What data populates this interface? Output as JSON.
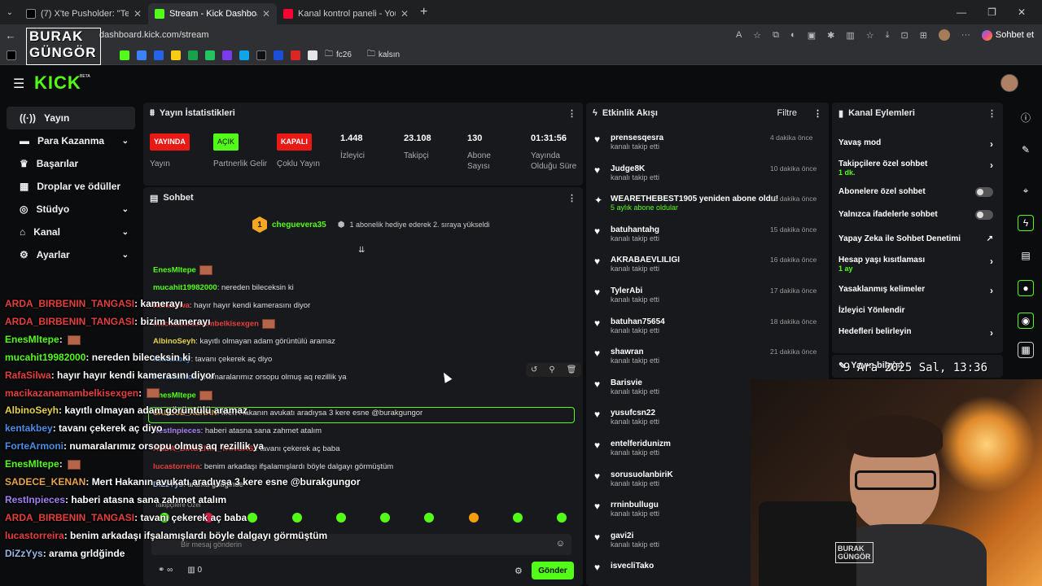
{
  "browser": {
    "tabs": [
      {
        "title": "(7) X'te Pusholder: \"Telefon dolandı",
        "color": "#222"
      },
      {
        "title": "Stream - Kick Dashboard",
        "color": "#53fc18"
      },
      {
        "title": "Kanal kontrol paneli - YouTube Stu",
        "color": "#ff0033"
      }
    ],
    "url": "dashboard.kick.com/stream",
    "copilot_label": "Sohbet et",
    "bookmarks": [
      "fc26",
      "kalsın"
    ]
  },
  "watermark": {
    "line1": "BURAK",
    "line2": "GÜNGÖR"
  },
  "clock": "9 Ara 2025 Sal, 13:36",
  "kick": {
    "logo": "KICK",
    "beta": "BETA",
    "nav": [
      {
        "label": "Yayın",
        "icon": "broadcast-icon",
        "chev": false
      },
      {
        "label": "Para Kazanma",
        "icon": "money-icon",
        "chev": true
      },
      {
        "label": "Başarılar",
        "icon": "trophy-icon",
        "chev": false
      },
      {
        "label": "Droplar ve ödüller",
        "icon": "gift-icon",
        "chev": false
      },
      {
        "label": "Stüdyo",
        "icon": "studio-icon",
        "chev": true
      },
      {
        "label": "Kanal",
        "icon": "channel-icon",
        "chev": true
      },
      {
        "label": "Ayarlar",
        "icon": "gear-icon",
        "chev": true
      }
    ]
  },
  "stats": {
    "title": "Yayın İstatistikleri",
    "live_badge": "YAYINDA",
    "live_label": "Yayın",
    "partner_badge": "AÇIK",
    "partner_label": "Partnerlik Gelir",
    "multi_badge": "KAPALI",
    "multi_label": "Çoklu Yayın",
    "viewers": "1.448",
    "viewers_label": "İzleyici",
    "followers": "23.108",
    "followers_label": "Takipçi",
    "subs": "130",
    "subs_label": "Abone Sayısı",
    "uptime": "01:31:56",
    "uptime_label": "Yayında Olduğu Süre"
  },
  "chat": {
    "title": "Sohbet",
    "pinned_user": "cheguevera35",
    "pinned_count": "1",
    "pinned_text": "1 abonelik hediye ederek 2. sıraya yükseldi",
    "messages": [
      {
        "user": "EnesMltepe",
        "color": "#53fc18",
        "text": ""
      },
      {
        "user": "mucahit19982000",
        "color": "#53fc18",
        "text": ": nereden bileceksin ki"
      },
      {
        "user": "RafaSilwa",
        "color": "#e53e3e",
        "text": ": hayır hayır kendi kamerasını diyor"
      },
      {
        "user": "macikazanamambelkisexgen",
        "color": "#e53e3e",
        "text": ""
      },
      {
        "user": "AlbinoSeyh",
        "color": "#e6d34a",
        "text": ": kayıtlı olmayan adam görüntülü aramaz"
      },
      {
        "user": "kentakbey",
        "color": "#4a8fe6",
        "text": ": tavanı çekerek aç diyo"
      },
      {
        "user": "ForteArmoni",
        "color": "#4a8fe6",
        "text": ": numaralarımız orsopu olmuş aq rezillik ya"
      },
      {
        "user": "EnesMltepe",
        "color": "#53fc18",
        "text": ""
      },
      {
        "user": "SADECE_KENAN",
        "color": "#e6a54a",
        "text": ": Mert Hakanın avukatı aradıysa 3 kere esne @burakgungor"
      },
      {
        "user": "RestInpieces",
        "color": "#a47ef0",
        "text": ": haberi atasna sana zahmet atalım"
      },
      {
        "user": "ARDA_BIRBENIN_TANGASI",
        "color": "#e53e3e",
        "text": ": tavanı çekerek aç baba"
      },
      {
        "user": "lucastorreira",
        "color": "#e53e3e",
        "text": ": benim arkadaşı ifşalamışlardı böyle dalgayı görmüştüm"
      },
      {
        "user": "DiZzYys",
        "color": "#9ab6e6",
        "text": ": arama grldğinde"
      }
    ],
    "followers_only": "Takipçilere Özel",
    "input_placeholder": "Bir mesaj gönderin",
    "send": "Gönder",
    "viewer_count": "∞",
    "points": "0"
  },
  "activity": {
    "title": "Etkinlik Akışı",
    "filter": "Filtre",
    "items": [
      {
        "name": "prensesqesra",
        "sub": "kanalı takip etti",
        "time": "4 dakika önce"
      },
      {
        "name": "Judge8K",
        "sub": "kanalı takip etti",
        "time": "10 dakika önce"
      },
      {
        "name": "WEARETHEBEST1905 yeniden abone oldu!",
        "sub": "5 aylık abone oldular",
        "time": "15 dakika önce",
        "special": true
      },
      {
        "name": "batuhantahg",
        "sub": "kanalı takip etti",
        "time": "15 dakika önce"
      },
      {
        "name": "AKRABAEVLILIGI",
        "sub": "kanalı takip etti",
        "time": "16 dakika önce"
      },
      {
        "name": "TylerAbi",
        "sub": "kanalı takip etti",
        "time": "17 dakika önce"
      },
      {
        "name": "batuhan75654",
        "sub": "kanalı takip etti",
        "time": "18 dakika önce"
      },
      {
        "name": "shawran",
        "sub": "kanalı takip etti",
        "time": "21 dakika önce"
      },
      {
        "name": "Barisvie",
        "sub": "kanalı takip etti",
        "time": ""
      },
      {
        "name": "yusufcsn22",
        "sub": "kanalı takip etti",
        "time": ""
      },
      {
        "name": "entelferidunizm",
        "sub": "kanalı takip etti",
        "time": ""
      },
      {
        "name": "sorusuolanbiriK",
        "sub": "kanalı takip etti",
        "time": ""
      },
      {
        "name": "rrninbullugu",
        "sub": "kanalı takip etti",
        "time": ""
      },
      {
        "name": "gavi2i",
        "sub": "kanalı takip etti",
        "time": ""
      },
      {
        "name": "isvecliTako",
        "sub": "",
        "time": ""
      }
    ]
  },
  "channel_actions": {
    "title": "Kanal Eylemleri",
    "items": [
      {
        "label": "Yavaş mod",
        "sub": "",
        "kind": "arrow"
      },
      {
        "label": "Takipçilere özel sohbet",
        "sub": "1 dk.",
        "kind": "arrow"
      },
      {
        "label": "Abonelere özel sohbet",
        "sub": "",
        "kind": "toggle"
      },
      {
        "label": "Yalnızca ifadelerle sohbet",
        "sub": "",
        "kind": "toggle"
      },
      {
        "label": "Yapay Zeka ile Sohbet Denetimi",
        "sub": "",
        "kind": "ext"
      },
      {
        "label": "Hesap yaşı kısıtlaması",
        "sub": "1 ay",
        "kind": "arrow"
      },
      {
        "label": "Yasaklanmış kelimeler",
        "sub": "",
        "kind": "arrow"
      },
      {
        "label": "İzleyici Yönlendir",
        "sub": "",
        "kind": "none"
      },
      {
        "label": "Hedefleri belirleyin",
        "sub": "",
        "kind": "arrow"
      }
    ],
    "stream_info": "Yayın bilgisi"
  },
  "overlay_chat": [
    {
      "user": "ARDA_BIRBENIN_TANGASI",
      "color": "#e53e3e",
      "text": ": kamerayı"
    },
    {
      "user": "ARDA_BIRBENIN_TANGASI",
      "color": "#e53e3e",
      "text": ": bizim kamerayı"
    },
    {
      "user": "EnesMltepe",
      "color": "#53fc18",
      "text": ":"
    },
    {
      "user": "mucahit19982000",
      "color": "#53fc18",
      "text": ": nereden bileceksin ki"
    },
    {
      "user": "RafaSilwa",
      "color": "#e53e3e",
      "text": ": hayır hayır kendi kamerasını diyor"
    },
    {
      "user": "macikazanamambelkisexgen",
      "color": "#e53e3e",
      "text": ":"
    },
    {
      "user": "AlbinoSeyh",
      "color": "#e6d34a",
      "text": ": kayıtlı olmayan adam görüntülü aramaz"
    },
    {
      "user": "kentakbey",
      "color": "#4a8fe6",
      "text": ": tavanı çekerek aç diyo"
    },
    {
      "user": "ForteArmoni",
      "color": "#4a8fe6",
      "text": ": numaralarımız orsopu olmuş aq rezillik ya"
    },
    {
      "user": "EnesMltepe",
      "color": "#53fc18",
      "text": ":"
    },
    {
      "user": "SADECE_KENAN",
      "color": "#e6a54a",
      "text": ": Mert Hakanın avukatı aradıysa 3 kere esne @burakgungor"
    },
    {
      "user": "RestInpieces",
      "color": "#a47ef0",
      "text": ": haberi atasna sana zahmet atalım"
    },
    {
      "user": "ARDA_BIRBENIN_TANGASI",
      "color": "#e53e3e",
      "text": ": tavanı çekerek aç baba"
    },
    {
      "user": "lucastorreira",
      "color": "#e53e3e",
      "text": ": benim arkadaşı ifşalamışlardı böyle dalgayı görmüştüm"
    },
    {
      "user": "DiZzYys",
      "color": "#9ab6e6",
      "text": ": arama grldğinde"
    }
  ],
  "webcam_logo": {
    "line1": "BURAK",
    "line2": "GÜNGÖR"
  },
  "colors": {
    "accent": "#53fc18",
    "live": "#e91916"
  }
}
